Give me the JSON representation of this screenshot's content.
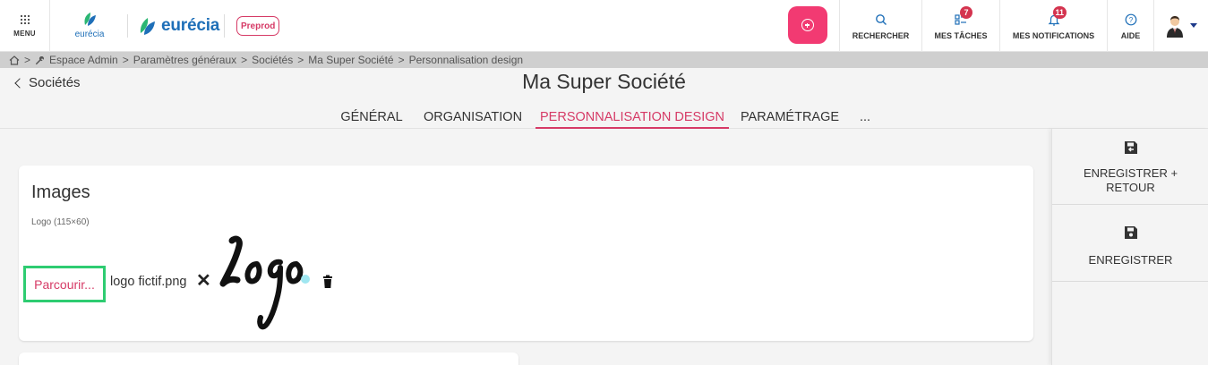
{
  "header": {
    "menu_label": "MENU",
    "logo_small_text": "eurécia",
    "logo_big_text": "eurécia",
    "env_badge": "Preprod",
    "search_label": "RECHERCHER",
    "tasks_label": "MES TÂCHES",
    "tasks_count": "7",
    "notifications_label": "MES NOTIFICATIONS",
    "notifications_count": "11",
    "help_label": "AIDE",
    "colors": {
      "accent": "#f23a72",
      "brand_blue": "#1e6fb8",
      "badge": "#d4344f"
    }
  },
  "breadcrumb": {
    "separator": ">",
    "items": [
      "Espace Admin",
      "Paramètres généraux",
      "Sociétés",
      "Ma Super Société",
      "Personnalisation design"
    ]
  },
  "page": {
    "back_label": "Sociétés",
    "title": "Ma Super Société",
    "tabs": [
      {
        "label": "GÉNÉRAL",
        "active": false
      },
      {
        "label": "ORGANISATION",
        "active": false
      },
      {
        "label": "PERSONNALISATION DESIGN",
        "active": true
      },
      {
        "label": "PARAMÉTRAGE",
        "active": false
      },
      {
        "label": "...",
        "active": false
      }
    ]
  },
  "images_section": {
    "title": "Images",
    "logo_field_label": "Logo (115×60)",
    "browse_label": "Parcourir...",
    "file_name": "logo fictif.png",
    "clear_symbol": "✕",
    "preview_alt": "Logo"
  },
  "side_panel": {
    "save_and_return_label": "ENREGISTRER + RETOUR",
    "save_label": "ENREGISTRER"
  }
}
